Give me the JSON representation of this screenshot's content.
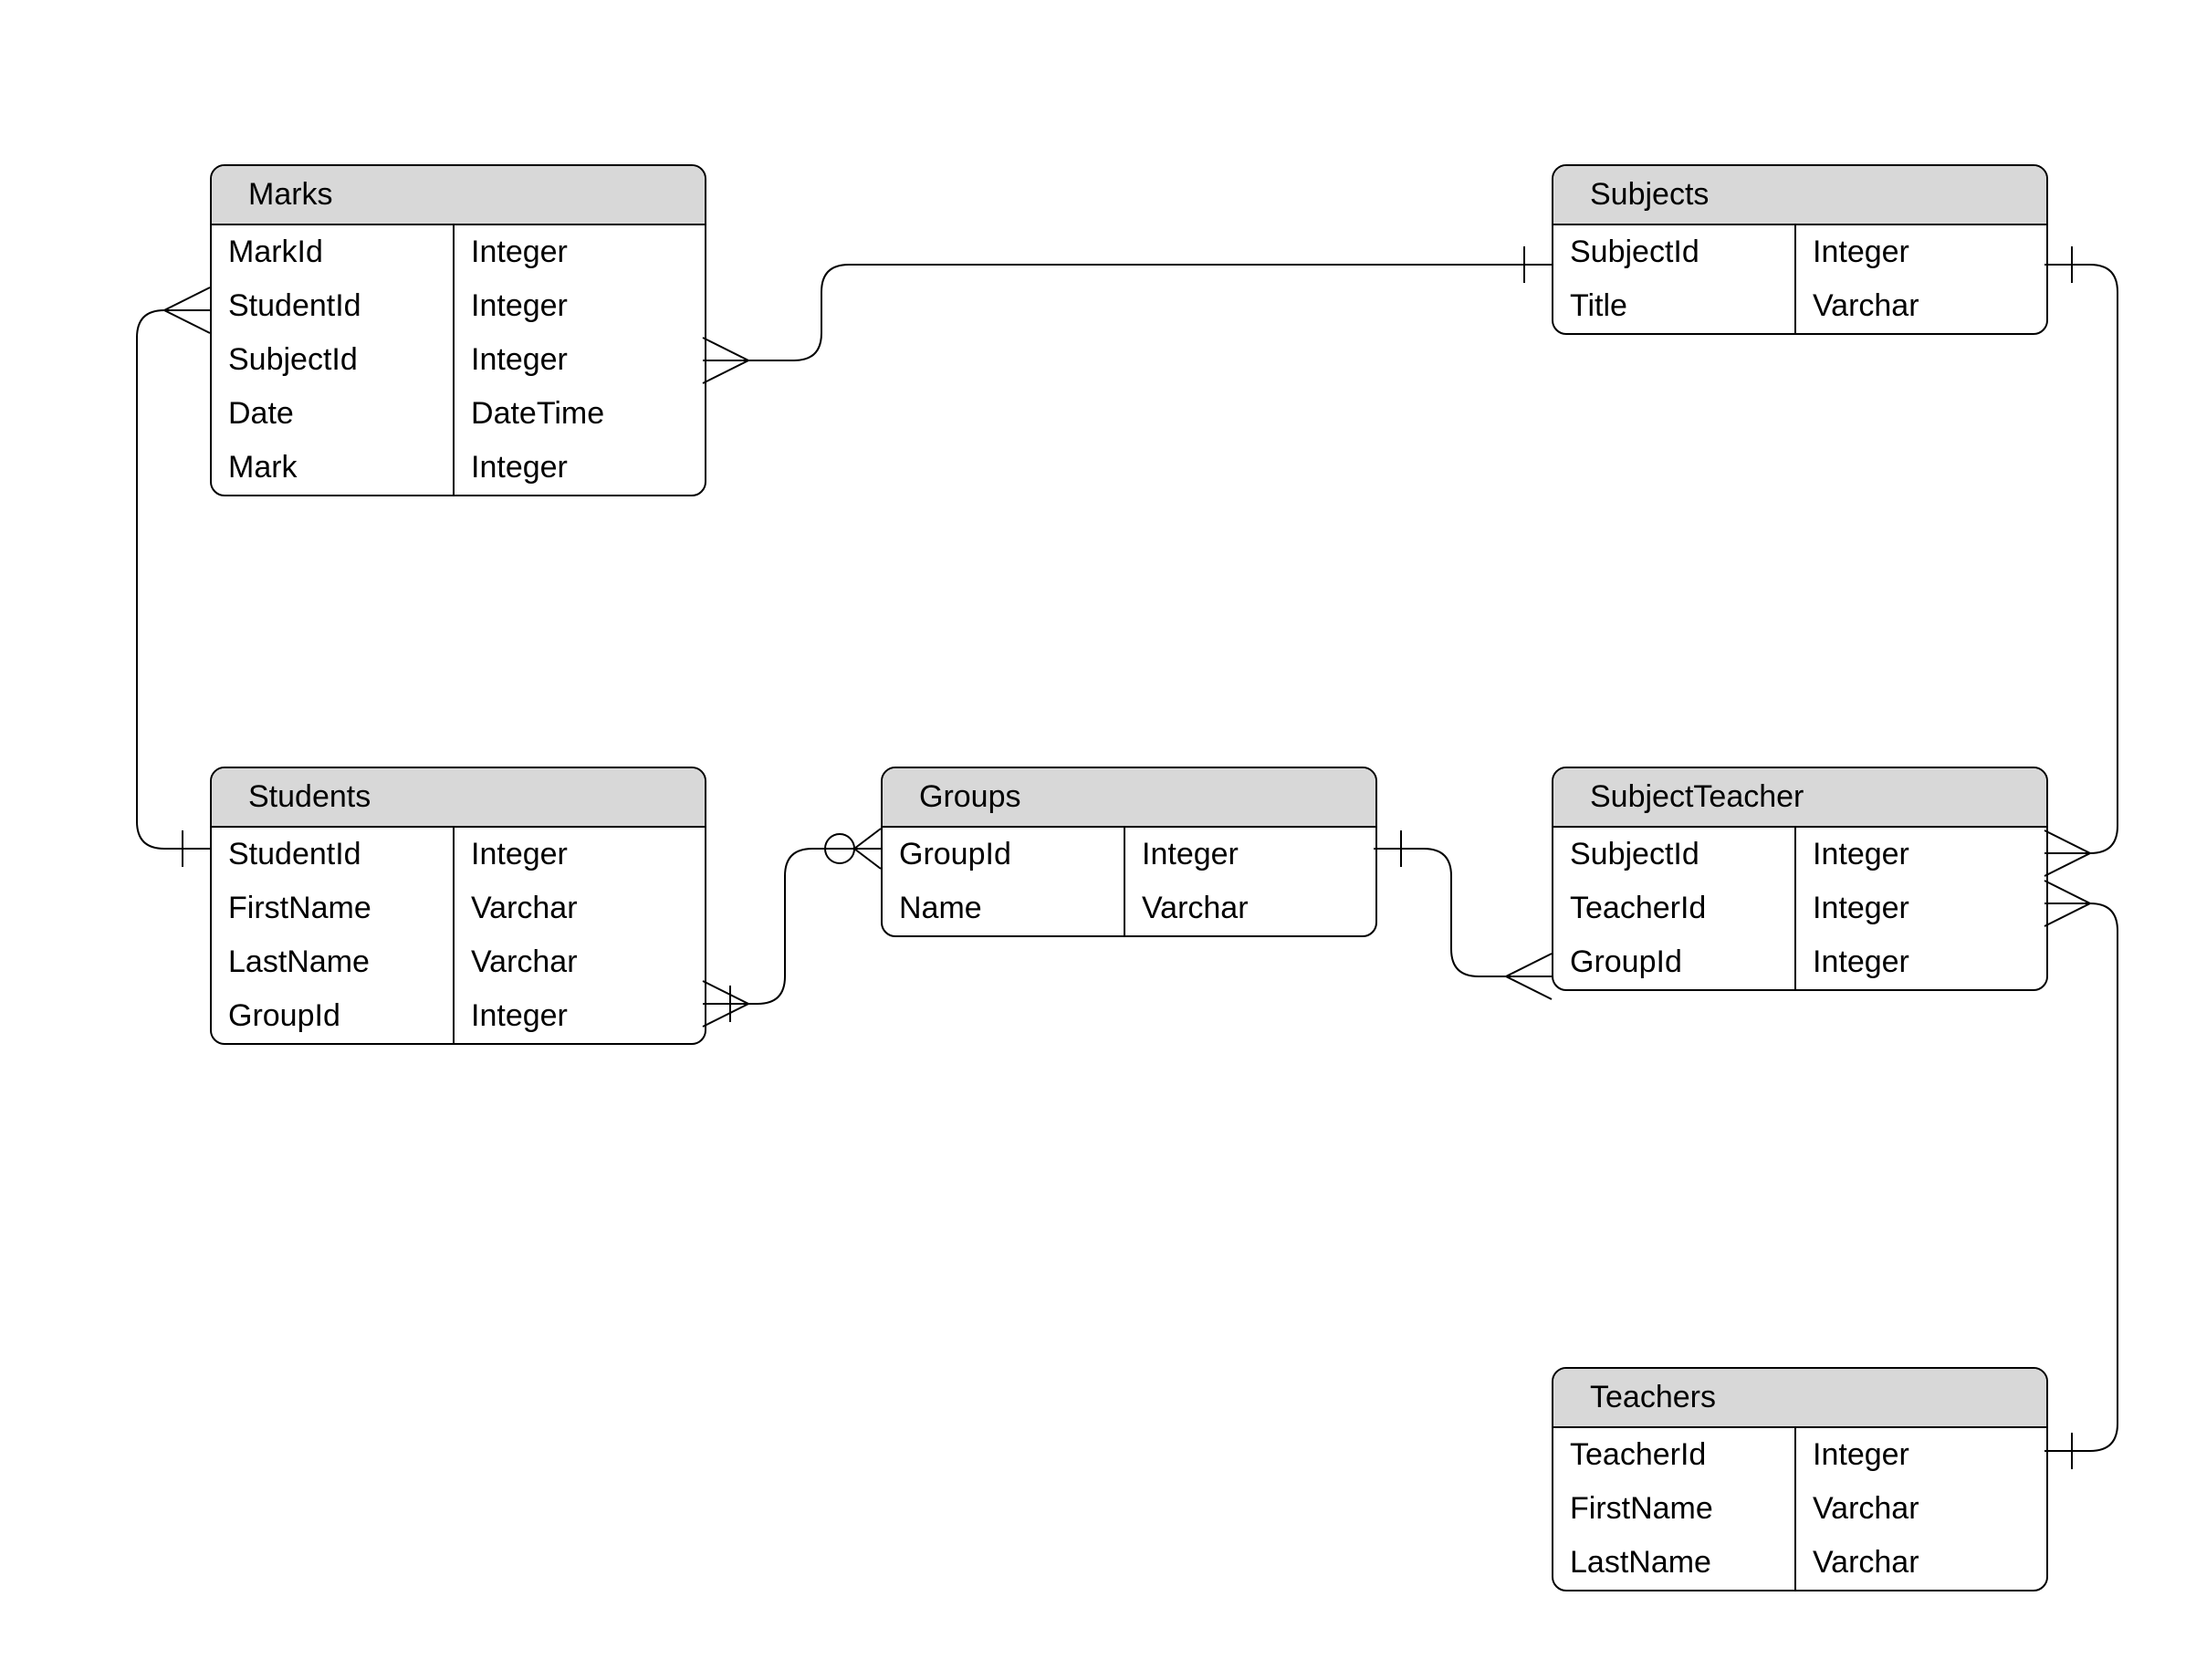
{
  "entities": {
    "marks": {
      "title": "Marks",
      "cols": [
        [
          "MarkId",
          "Integer"
        ],
        [
          "StudentId",
          "Integer"
        ],
        [
          "SubjectId",
          "Integer"
        ],
        [
          "Date",
          "DateTime"
        ],
        [
          "Mark",
          "Integer"
        ]
      ]
    },
    "subjects": {
      "title": "Subjects",
      "cols": [
        [
          "SubjectId",
          "Integer"
        ],
        [
          "Title",
          "Varchar"
        ]
      ]
    },
    "students": {
      "title": "Students",
      "cols": [
        [
          "StudentId",
          "Integer"
        ],
        [
          "FirstName",
          "Varchar"
        ],
        [
          "LastName",
          "Varchar"
        ],
        [
          "GroupId",
          "Integer"
        ]
      ]
    },
    "groups": {
      "title": "Groups",
      "cols": [
        [
          "GroupId",
          "Integer"
        ],
        [
          "Name",
          "Varchar"
        ]
      ]
    },
    "subjectteacher": {
      "title": "SubjectTeacher",
      "cols": [
        [
          "SubjectId",
          "Integer"
        ],
        [
          "TeacherId",
          "Integer"
        ],
        [
          "GroupId",
          "Integer"
        ]
      ]
    },
    "teachers": {
      "title": "Teachers",
      "cols": [
        [
          "TeacherId",
          "Integer"
        ],
        [
          "FirstName",
          "Varchar"
        ],
        [
          "LastName",
          "Varchar"
        ]
      ]
    }
  },
  "relationships": [
    {
      "from": "Marks",
      "to": "Subjects",
      "type": "many-to-one"
    },
    {
      "from": "Marks",
      "to": "Students",
      "type": "many-to-one"
    },
    {
      "from": "Students",
      "to": "Groups",
      "type": "many-to-zero-or-one"
    },
    {
      "from": "Groups",
      "to": "SubjectTeacher",
      "type": "one-to-many"
    },
    {
      "from": "Subjects",
      "to": "SubjectTeacher",
      "type": "one-to-many"
    },
    {
      "from": "Teachers",
      "to": "SubjectTeacher",
      "type": "one-to-many"
    }
  ]
}
